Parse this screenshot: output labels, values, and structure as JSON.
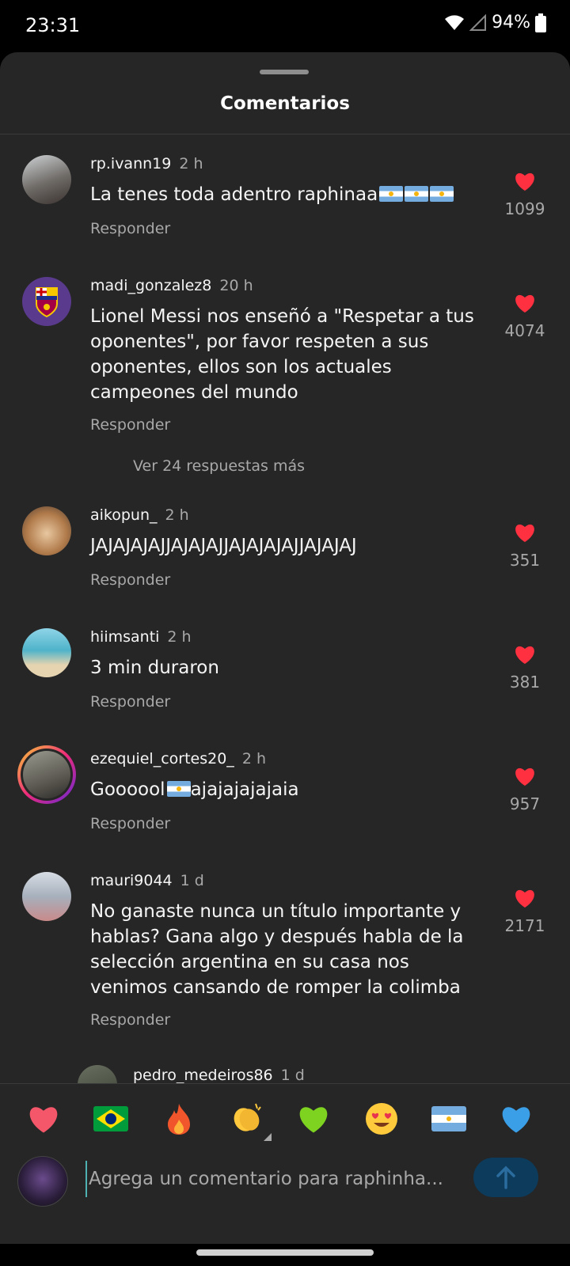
{
  "status": {
    "time": "23:31",
    "battery": "94%"
  },
  "sheet": {
    "title": "Comentarios"
  },
  "comments": [
    {
      "user": "rp.ivann19",
      "ago": "2 h",
      "text": "La tenes toda adentro raphinaa",
      "likes": "1099",
      "reply": "Responder"
    },
    {
      "user": "madi_gonzalez8",
      "ago": "20 h",
      "text": "Lionel Messi nos enseñó a \"Respetar a tus oponentes\", por favor respeten a sus oponentes, ellos son los actuales campeones del mundo",
      "likes": "4074",
      "reply": "Responder",
      "more": "Ver 24 respuestas más"
    },
    {
      "user": "aikopun_",
      "ago": "2 h",
      "text": "JAJAJAJAJJAJAJAJJAJAJAJAJJAJAJAJ",
      "likes": "351",
      "reply": "Responder"
    },
    {
      "user": "hiimsanti",
      "ago": "2 h",
      "text": "3 min duraron",
      "likes": "381",
      "reply": "Responder"
    },
    {
      "user": "ezequiel_cortes20_",
      "ago": "2 h",
      "text_a": "Goooool",
      "text_b": "ajajajajajaia",
      "likes": "957",
      "reply": "Responder"
    },
    {
      "user": "mauri9044",
      "ago": "1 d",
      "text": "No ganaste nunca un título importante y hablas? Gana algo y después habla de la selección argentina en su casa nos venimos cansando de romper la colimba",
      "likes": "2171",
      "reply": "Responder"
    },
    {
      "user": "pedro_medeiros86",
      "ago": "1 d"
    }
  ],
  "emoji_bar": [
    "heart",
    "brazil-flag",
    "fire",
    "clapping-hands",
    "green-heart",
    "heart-eyes",
    "argentina-flag",
    "blue-heart"
  ],
  "composer": {
    "placeholder": "Agrega un comentario para raphinha..."
  },
  "colors": {
    "background": "#262626",
    "like": "#ff3040",
    "send": "#0d3b5c"
  }
}
